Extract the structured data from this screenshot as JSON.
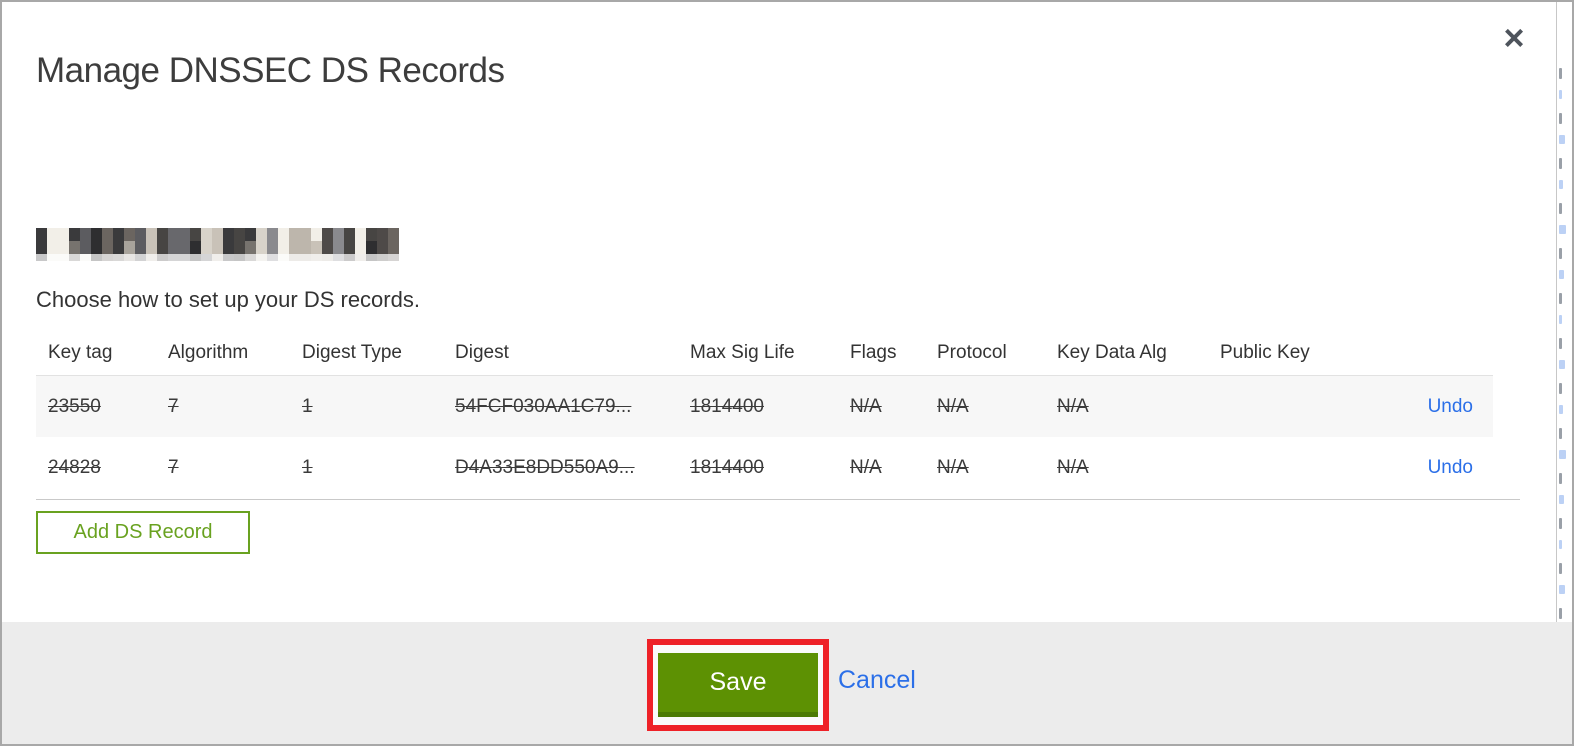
{
  "modal": {
    "title": "Manage DNSSEC DS Records",
    "close_icon": "×",
    "redacted_domain_note": "domain name (pixelated/redacted)",
    "instruction": "Choose how to set up your DS records.",
    "table": {
      "headers": [
        "Key tag",
        "Algorithm",
        "Digest Type",
        "Digest",
        "Max Sig Life",
        "Flags",
        "Protocol",
        "Key Data Alg",
        "Public Key"
      ],
      "rows": [
        {
          "cells": [
            "23550",
            "7",
            "1",
            "54FCF030AA1C79...",
            "1814400",
            "N/A",
            "N/A",
            "N/A",
            ""
          ],
          "action": "Undo",
          "deleted": true
        },
        {
          "cells": [
            "24828",
            "7",
            "1",
            "D4A33E8DD550A9...",
            "1814400",
            "N/A",
            "N/A",
            "N/A",
            ""
          ],
          "action": "Undo",
          "deleted": true
        }
      ]
    },
    "add_button_label": "Add DS Record",
    "footer": {
      "save_label": "Save",
      "cancel_label": "Cancel"
    }
  },
  "colors": {
    "green_accent": "#69a220",
    "green_button": "#5d9103",
    "green_button_dark": "#4b7a03",
    "blue_link": "#2b6fe8",
    "red_annotation": "#ee2127",
    "footer_bg": "#ececec",
    "row_stripe": "#f7f7f7",
    "text": "#3a3a3a"
  }
}
